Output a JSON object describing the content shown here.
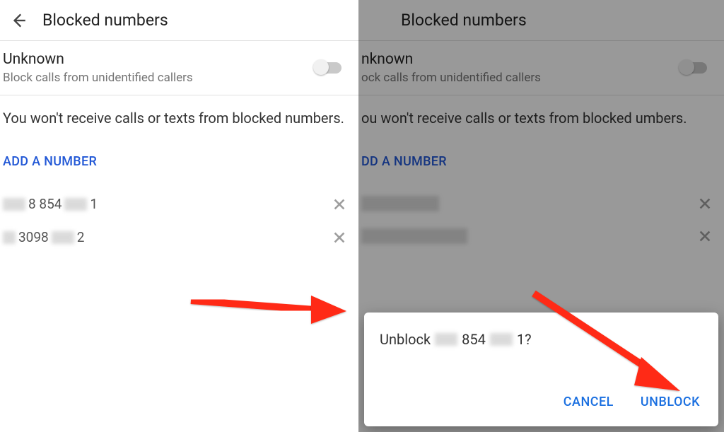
{
  "left": {
    "header": {
      "title": "Blocked numbers"
    },
    "unknown": {
      "label": "Unknown",
      "subtitle": "Block calls from unidentified callers",
      "enabled": false
    },
    "info": "You won't receive calls or texts from blocked numbers.",
    "add_label": "ADD A NUMBER",
    "numbers": [
      {
        "visible_mid": "8 854",
        "trailing": "1"
      },
      {
        "visible_mid": "3098",
        "trailing": "2"
      }
    ]
  },
  "right": {
    "header": {
      "title": "Blocked numbers"
    },
    "unknown": {
      "label": "nknown",
      "subtitle": "ock calls from unidentified callers",
      "enabled": false
    },
    "info": "ou won't receive calls or texts from blocked umbers.",
    "add_label": "DD A NUMBER",
    "dialog": {
      "prefix": "Unblock",
      "visible_mid": "854",
      "suffix": "1?",
      "cancel": "CANCEL",
      "confirm": "UNBLOCK"
    }
  },
  "colors": {
    "accent": "#1a6fe0",
    "link": "#2258d6",
    "arrow": "#ff2a12"
  }
}
